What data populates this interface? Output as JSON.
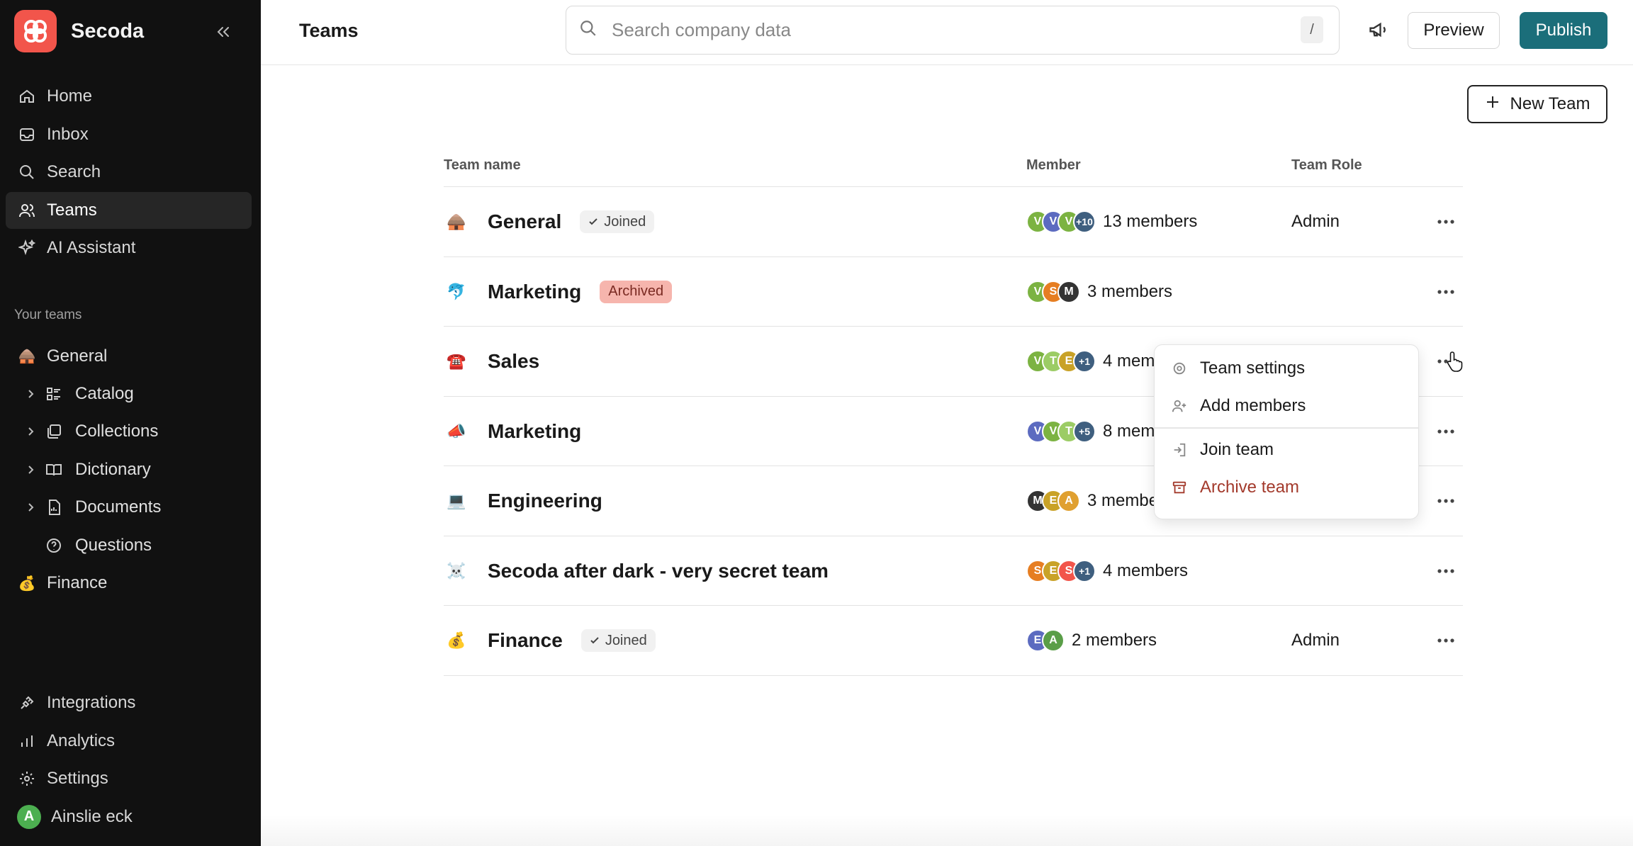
{
  "app": {
    "name": "Secoda"
  },
  "sidebar": {
    "nav": [
      {
        "label": "Home",
        "icon": "home-icon"
      },
      {
        "label": "Inbox",
        "icon": "inbox-icon"
      },
      {
        "label": "Search",
        "icon": "search-icon"
      },
      {
        "label": "Teams",
        "icon": "users-icon",
        "active": true
      },
      {
        "label": "AI Assistant",
        "icon": "sparkles-icon"
      }
    ],
    "teams_section_label": "Your teams",
    "teams_tree": [
      {
        "label": "General",
        "emoji": "🛖"
      },
      {
        "label": "Catalog",
        "icon": "catalog-icon"
      },
      {
        "label": "Collections",
        "icon": "collections-icon"
      },
      {
        "label": "Dictionary",
        "icon": "book-icon"
      },
      {
        "label": "Documents",
        "icon": "document-icon"
      },
      {
        "label": "Questions",
        "icon": "question-icon"
      },
      {
        "label": "Finance",
        "emoji": "💰"
      }
    ],
    "bottom_nav": [
      {
        "label": "Integrations",
        "icon": "plug-icon"
      },
      {
        "label": "Analytics",
        "icon": "bar-chart-icon"
      },
      {
        "label": "Settings",
        "icon": "gear-icon"
      },
      {
        "label": "Ainslie eck",
        "avatar_letter": "A"
      }
    ]
  },
  "header": {
    "title": "Teams",
    "search_placeholder": "Search company data",
    "search_shortcut": "/",
    "preview_label": "Preview",
    "publish_label": "Publish"
  },
  "new_team_label": "New Team",
  "table": {
    "columns": [
      "Team name",
      "Member",
      "Team Role"
    ],
    "rows": [
      {
        "emoji": "🛖",
        "name": "General",
        "badge": "Joined",
        "badge_type": "joined",
        "avatars": [
          {
            "l": "V",
            "c": "#7cb342"
          },
          {
            "l": "V",
            "c": "#5c6bc0"
          },
          {
            "l": "V",
            "c": "#7cb342"
          },
          {
            "l": "+10",
            "more": true
          }
        ],
        "members": "13 members",
        "role": "Admin"
      },
      {
        "emoji": "🐬",
        "name": "Marketing",
        "badge": "Archived",
        "badge_type": "archived",
        "avatars": [
          {
            "l": "V",
            "c": "#7cb342"
          },
          {
            "l": "S",
            "c": "#e67e22"
          },
          {
            "l": "M",
            "c": "#333333"
          }
        ],
        "members": "3 members",
        "role": ""
      },
      {
        "emoji": "☎️",
        "name": "Sales",
        "badge": "",
        "badge_type": "",
        "avatars": [
          {
            "l": "V",
            "c": "#7cb342"
          },
          {
            "l": "T",
            "c": "#9ccc65"
          },
          {
            "l": "E",
            "c": "#c9a227"
          },
          {
            "l": "+1",
            "more": true
          }
        ],
        "members": "4 members",
        "role": ""
      },
      {
        "emoji": "📣",
        "name": "Marketing",
        "badge": "",
        "badge_type": "",
        "avatars": [
          {
            "l": "V",
            "c": "#5c6bc0"
          },
          {
            "l": "V",
            "c": "#7cb342"
          },
          {
            "l": "T",
            "c": "#9ccc65"
          },
          {
            "l": "+5",
            "more": true
          }
        ],
        "members": "8 members",
        "role": ""
      },
      {
        "emoji": "💻",
        "name": "Engineering",
        "badge": "",
        "badge_type": "",
        "avatars": [
          {
            "l": "M",
            "c": "#333333"
          },
          {
            "l": "E",
            "c": "#c9a227"
          },
          {
            "l": "A",
            "c": "#e0a030"
          }
        ],
        "members": "3 members",
        "role": ""
      },
      {
        "emoji": "☠️",
        "name": "Secoda after dark - very secret team",
        "badge": "",
        "badge_type": "",
        "avatars": [
          {
            "l": "S",
            "c": "#e67e22"
          },
          {
            "l": "E",
            "c": "#c9a227"
          },
          {
            "l": "S",
            "c": "#f2554b"
          },
          {
            "l": "+1",
            "more": true
          }
        ],
        "members": "4 members",
        "role": ""
      },
      {
        "emoji": "💰",
        "name": "Finance",
        "badge": "Joined",
        "badge_type": "joined",
        "avatars": [
          {
            "l": "E",
            "c": "#5c6bc0"
          },
          {
            "l": "A",
            "c": "#5a9e48"
          }
        ],
        "members": "2 members",
        "role": "Admin"
      }
    ]
  },
  "dropdown": {
    "items": [
      {
        "label": "Team settings",
        "icon": "gear-icon"
      },
      {
        "label": "Add members",
        "icon": "user-plus-icon"
      },
      {
        "label": "Join team",
        "icon": "door-enter-icon"
      },
      {
        "label": "Archive team",
        "icon": "archive-icon",
        "danger": true
      }
    ]
  },
  "colors": {
    "sidebar_bg": "#111111",
    "brand": "#f2554b",
    "publish": "#1b6e7a",
    "danger": "#a33a2c"
  }
}
